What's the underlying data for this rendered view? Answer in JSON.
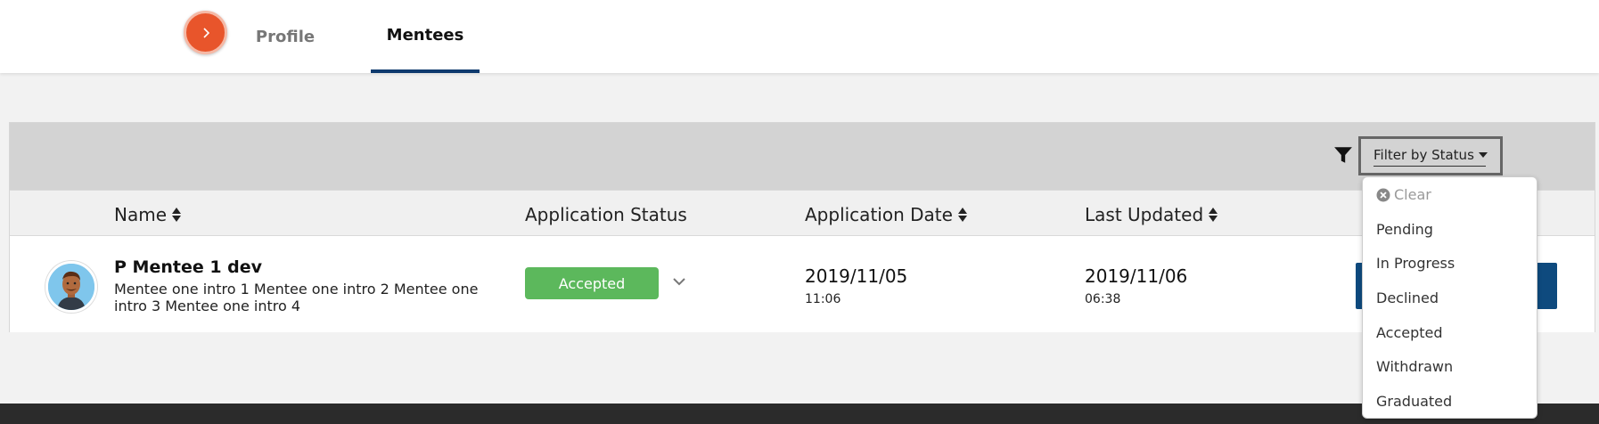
{
  "nav": {
    "tabs": [
      {
        "label": "Profile"
      },
      {
        "label": "Mentees"
      }
    ],
    "active_tab": "Mentees"
  },
  "filter": {
    "label": "Filter by Status",
    "options": [
      "Clear",
      "Pending",
      "In Progress",
      "Declined",
      "Accepted",
      "Withdrawn",
      "Graduated"
    ]
  },
  "table": {
    "columns": [
      "Name",
      "Application Status",
      "Application Date",
      "Last Updated"
    ],
    "rows": [
      {
        "name": "P Mentee 1 dev",
        "intro": "Mentee one intro 1 Mentee one intro 2 Mentee one intro 3 Mentee one intro 4",
        "status": "Accepted",
        "application_date": "2019/11/05",
        "application_time": "11:06",
        "last_updated_date": "2019/11/06",
        "last_updated_time": "06:38"
      }
    ]
  },
  "colors": {
    "accent_orange": "#e8552b",
    "nav_active": "#0e3a6e",
    "status_accepted": "#5cb85c",
    "primary_button": "#0e4a7e"
  },
  "icons": [
    "chevron-right-icon",
    "filter-icon",
    "sort-icon",
    "chevron-down-icon",
    "clear-circle-icon"
  ]
}
